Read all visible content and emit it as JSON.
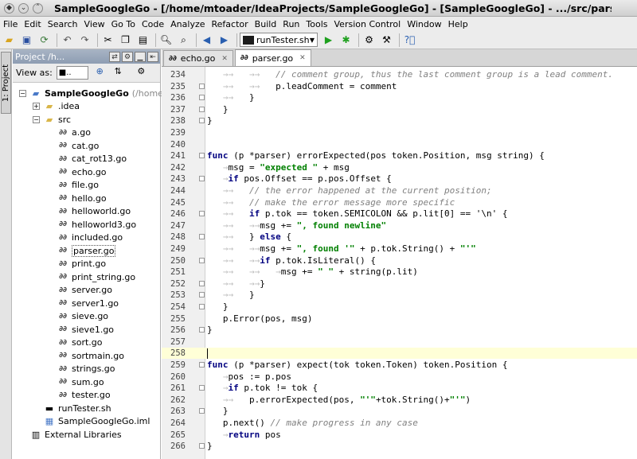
{
  "window": {
    "title": "SampleGoogleGo - [/home/mtoader/IdeaProjects/SampleGoogleGo] - [SampleGoogleGo] - .../src/parser.go - IntelliJ"
  },
  "menu": [
    "File",
    "Edit",
    "Search",
    "View",
    "Go To",
    "Code",
    "Analyze",
    "Refactor",
    "Build",
    "Run",
    "Tools",
    "Version Control",
    "Window",
    "Help"
  ],
  "toolbar": {
    "run_config": "runTester.sh"
  },
  "sidebar": {
    "tab_label": "1: Project"
  },
  "project": {
    "header": "Project /h...",
    "view_as_label": "View as:",
    "view_as_value": "■..",
    "tree": [
      {
        "label": "SampleGoogleGo",
        "hint": "(/home/m",
        "kind": "project",
        "level": 0,
        "expanded": true
      },
      {
        "label": ".idea",
        "kind": "folder",
        "level": 1,
        "expanded": false
      },
      {
        "label": "src",
        "kind": "folder",
        "level": 1,
        "expanded": true
      },
      {
        "label": "a.go",
        "kind": "go",
        "level": 2
      },
      {
        "label": "cat.go",
        "kind": "go",
        "level": 2
      },
      {
        "label": "cat_rot13.go",
        "kind": "go",
        "level": 2
      },
      {
        "label": "echo.go",
        "kind": "go",
        "level": 2
      },
      {
        "label": "file.go",
        "kind": "go",
        "level": 2
      },
      {
        "label": "hello.go",
        "kind": "go",
        "level": 2
      },
      {
        "label": "helloworld.go",
        "kind": "go",
        "level": 2
      },
      {
        "label": "helloworld3.go",
        "kind": "go",
        "level": 2
      },
      {
        "label": "included.go",
        "kind": "go",
        "level": 2
      },
      {
        "label": "parser.go",
        "kind": "go",
        "level": 2,
        "selected": true
      },
      {
        "label": "print.go",
        "kind": "go",
        "level": 2
      },
      {
        "label": "print_string.go",
        "kind": "go",
        "level": 2
      },
      {
        "label": "server.go",
        "kind": "go",
        "level": 2
      },
      {
        "label": "server1.go",
        "kind": "go",
        "level": 2
      },
      {
        "label": "sieve.go",
        "kind": "go",
        "level": 2
      },
      {
        "label": "sieve1.go",
        "kind": "go",
        "level": 2
      },
      {
        "label": "sort.go",
        "kind": "go",
        "level": 2
      },
      {
        "label": "sortmain.go",
        "kind": "go",
        "level": 2
      },
      {
        "label": "strings.go",
        "kind": "go",
        "level": 2
      },
      {
        "label": "sum.go",
        "kind": "go",
        "level": 2
      },
      {
        "label": "tester.go",
        "kind": "go",
        "level": 2
      },
      {
        "label": "runTester.sh",
        "kind": "sh",
        "level": 1
      },
      {
        "label": "SampleGoogleGo.iml",
        "kind": "iml",
        "level": 1
      },
      {
        "label": "External Libraries",
        "kind": "lib",
        "level": 0
      }
    ]
  },
  "editor": {
    "tabs": [
      {
        "label": "echo.go",
        "active": false
      },
      {
        "label": "parser.go",
        "active": true
      }
    ],
    "current_line": "258",
    "lines": [
      {
        "n": "234",
        "t": [
          [
            "ws",
            "   →→   →→   "
          ],
          [
            "cm",
            "// comment group, thus the last comment group is a lead comment."
          ]
        ]
      },
      {
        "n": "235",
        "t": [
          [
            "ws",
            "   →→   →→   "
          ],
          [
            "p",
            "p.leadComment = comment"
          ]
        ]
      },
      {
        "n": "236",
        "t": [
          [
            "ws",
            "   →→   "
          ],
          [
            "p",
            "}"
          ]
        ]
      },
      {
        "n": "237",
        "t": [
          [
            "ws",
            "   "
          ],
          [
            "p",
            "}"
          ]
        ]
      },
      {
        "n": "238",
        "t": [
          [
            "p",
            "}"
          ]
        ]
      },
      {
        "n": "239",
        "t": []
      },
      {
        "n": "240",
        "t": []
      },
      {
        "n": "241",
        "t": [
          [
            "kw",
            "func"
          ],
          [
            "p",
            " (p *parser) errorExpected(pos token.Position, msg string) {"
          ]
        ]
      },
      {
        "n": "242",
        "t": [
          [
            "ws",
            "   →"
          ],
          [
            "p",
            "msg = "
          ],
          [
            "str",
            "\"expected \""
          ],
          [
            "p",
            " + msg"
          ]
        ]
      },
      {
        "n": "243",
        "t": [
          [
            "ws",
            "   →"
          ],
          [
            "kw",
            "if"
          ],
          [
            "p",
            " pos.Offset == p.pos.Offset {"
          ]
        ]
      },
      {
        "n": "244",
        "t": [
          [
            "ws",
            "   →→   "
          ],
          [
            "cm",
            "// the error happened at the current position;"
          ]
        ]
      },
      {
        "n": "245",
        "t": [
          [
            "ws",
            "   →→   "
          ],
          [
            "cm",
            "// make the error message more specific"
          ]
        ]
      },
      {
        "n": "246",
        "t": [
          [
            "ws",
            "   →→   "
          ],
          [
            "kw",
            "if"
          ],
          [
            "p",
            " p.tok == token.SEMICOLON && p.lit[0] == '\\n' {"
          ]
        ]
      },
      {
        "n": "247",
        "t": [
          [
            "ws",
            "   →→   →→"
          ],
          [
            "p",
            "msg += "
          ],
          [
            "str",
            "\", found newline\""
          ]
        ]
      },
      {
        "n": "248",
        "t": [
          [
            "ws",
            "   →→   "
          ],
          [
            "p",
            "} "
          ],
          [
            "kw",
            "else"
          ],
          [
            "p",
            " {"
          ]
        ]
      },
      {
        "n": "249",
        "t": [
          [
            "ws",
            "   →→   →→"
          ],
          [
            "p",
            "msg += "
          ],
          [
            "str",
            "\", found '\""
          ],
          [
            "p",
            " + p.tok.String() + "
          ],
          [
            "str",
            "\"'\""
          ]
        ]
      },
      {
        "n": "250",
        "t": [
          [
            "ws",
            "   →→   →→"
          ],
          [
            "kw",
            "if"
          ],
          [
            "p",
            " p.tok.IsLiteral() {"
          ]
        ]
      },
      {
        "n": "251",
        "t": [
          [
            "ws",
            "   →→   →→   →"
          ],
          [
            "p",
            "msg += "
          ],
          [
            "str",
            "\" \""
          ],
          [
            "p",
            " + string(p.lit)"
          ]
        ]
      },
      {
        "n": "252",
        "t": [
          [
            "ws",
            "   →→   →→"
          ],
          [
            "p",
            "}"
          ]
        ]
      },
      {
        "n": "253",
        "t": [
          [
            "ws",
            "   →→   "
          ],
          [
            "p",
            "}"
          ]
        ]
      },
      {
        "n": "254",
        "t": [
          [
            "ws",
            "   "
          ],
          [
            "p",
            "}"
          ]
        ]
      },
      {
        "n": "255",
        "t": [
          [
            "ws",
            "   "
          ],
          [
            "p",
            "p.Error(pos, msg)"
          ]
        ]
      },
      {
        "n": "256",
        "t": [
          [
            "p",
            "}"
          ]
        ]
      },
      {
        "n": "257",
        "t": []
      },
      {
        "n": "258",
        "t": [],
        "caret": true
      },
      {
        "n": "259",
        "t": [
          [
            "kw",
            "func"
          ],
          [
            "p",
            " (p *parser) expect(tok token.Token) token.Position {"
          ]
        ]
      },
      {
        "n": "260",
        "t": [
          [
            "ws",
            "   →"
          ],
          [
            "p",
            "pos := p.pos"
          ]
        ]
      },
      {
        "n": "261",
        "t": [
          [
            "ws",
            "   →"
          ],
          [
            "kw",
            "if"
          ],
          [
            "p",
            " p.tok != tok {"
          ]
        ]
      },
      {
        "n": "262",
        "t": [
          [
            "ws",
            "   →→   "
          ],
          [
            "p",
            "p.errorExpected(pos, "
          ],
          [
            "str",
            "\"'\""
          ],
          [
            "p",
            "+tok.String()+"
          ],
          [
            "str",
            "\"'\""
          ],
          [
            "p",
            ")"
          ]
        ]
      },
      {
        "n": "263",
        "t": [
          [
            "ws",
            "   "
          ],
          [
            "p",
            "}"
          ]
        ]
      },
      {
        "n": "264",
        "t": [
          [
            "ws",
            "   "
          ],
          [
            "p",
            "p.next() "
          ],
          [
            "cm",
            "// make progress in any case"
          ]
        ]
      },
      {
        "n": "265",
        "t": [
          [
            "ws",
            "   →"
          ],
          [
            "kw",
            "return"
          ],
          [
            "p",
            " pos"
          ]
        ]
      },
      {
        "n": "266",
        "t": [
          [
            "p",
            "}"
          ]
        ]
      }
    ]
  }
}
